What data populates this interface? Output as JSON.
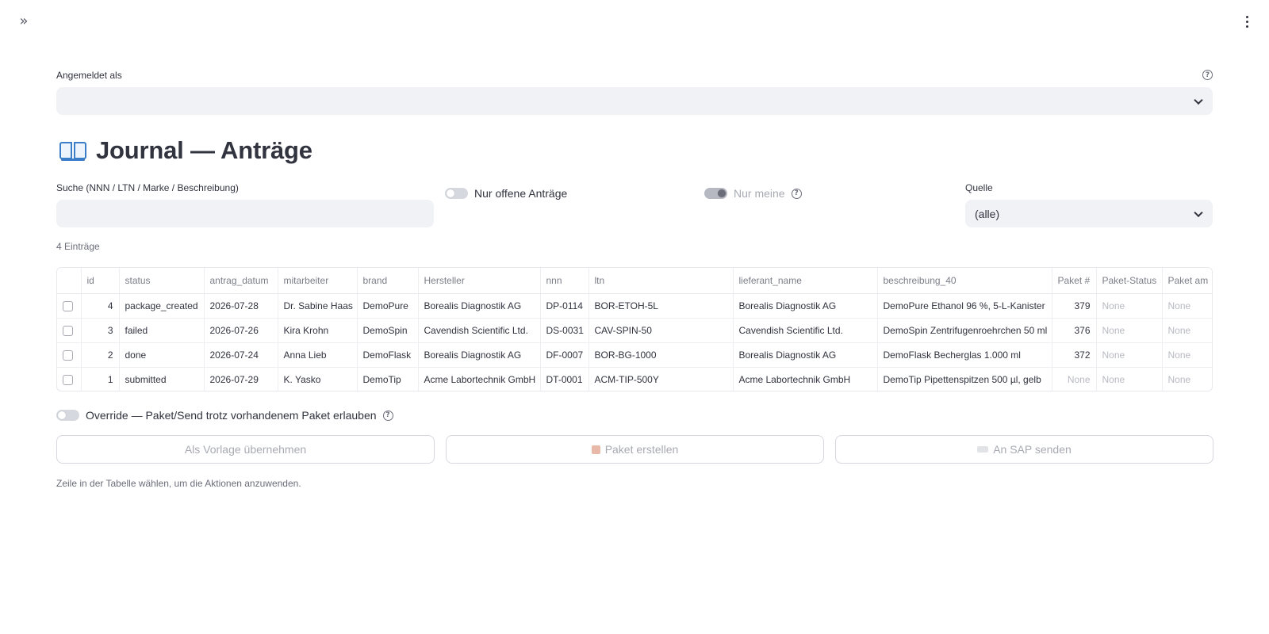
{
  "header": {
    "expand_icon": "chevrons-right-icon",
    "menu_icon": "vertical-dots-icon",
    "expand_glyph": "»"
  },
  "login": {
    "label": "Angemeldet als",
    "value": ""
  },
  "page": {
    "title": "Journal — Anträge",
    "title_icon": "open-book-icon"
  },
  "filters": {
    "search_label": "Suche (NNN / LTN / Marke / Beschreibung)",
    "search_value": "",
    "only_open_label": "Nur offene Anträge",
    "only_open_on": false,
    "only_mine_label": "Nur meine",
    "only_mine_on": true,
    "source_label": "Quelle",
    "source_value": "(alle)"
  },
  "count_text": "4 Einträge",
  "table": {
    "columns": [
      "id",
      "status",
      "antrag_datum",
      "mitarbeiter",
      "brand",
      "Hersteller",
      "nnn",
      "ltn",
      "lieferant_name",
      "beschreibung_40",
      "Paket #",
      "Paket-Status",
      "Paket am"
    ],
    "rows": [
      [
        "4",
        "package_created",
        "2026-07-28",
        "Dr. Sabine Haas",
        "DemoPure",
        "Borealis Diagnostik AG",
        "DP-0114",
        "BOR-ETOH-5L",
        "Borealis Diagnostik AG",
        "DemoPure Ethanol 96 %, 5-L-Kanister",
        "379",
        "None",
        "None"
      ],
      [
        "3",
        "failed",
        "2026-07-26",
        "Kira Krohn",
        "DemoSpin",
        "Cavendish Scientific Ltd.",
        "DS-0031",
        "CAV-SPIN-50",
        "Cavendish Scientific Ltd.",
        "DemoSpin Zentrifugenroehrchen 50 ml",
        "376",
        "None",
        "None"
      ],
      [
        "2",
        "done",
        "2026-07-24",
        "Anna Lieb",
        "DemoFlask",
        "Borealis Diagnostik AG",
        "DF-0007",
        "BOR-BG-1000",
        "Borealis Diagnostik AG",
        "DemoFlask Becherglas 1.000 ml",
        "372",
        "None",
        "None"
      ],
      [
        "1",
        "submitted",
        "2026-07-29",
        "K. Yasko",
        "DemoTip",
        "Acme Labortechnik GmbH",
        "DT-0001",
        "ACM-TIP-500Y",
        "Acme Labortechnik GmbH",
        "DemoTip Pipettenspitzen 500 µl, gelb",
        "None",
        "None",
        "None"
      ]
    ]
  },
  "override": {
    "label": "Override — Paket/Send trotz vorhandenem Paket erlauben",
    "on": false
  },
  "actions": {
    "template_label": "Als Vorlage übernehmen",
    "package_label": "Paket erstellen",
    "package_icon": "package-icon",
    "sap_label": "An SAP senden",
    "sap_icon": "laptop-icon"
  },
  "hint": "Zeile in der Tabelle wählen, um die Aktionen anzuwenden.",
  "colors": {
    "input_bg": "#f0f2f6",
    "text": "#31333f",
    "muted": "#6b6d7a",
    "disabled": "#a8aab3"
  }
}
